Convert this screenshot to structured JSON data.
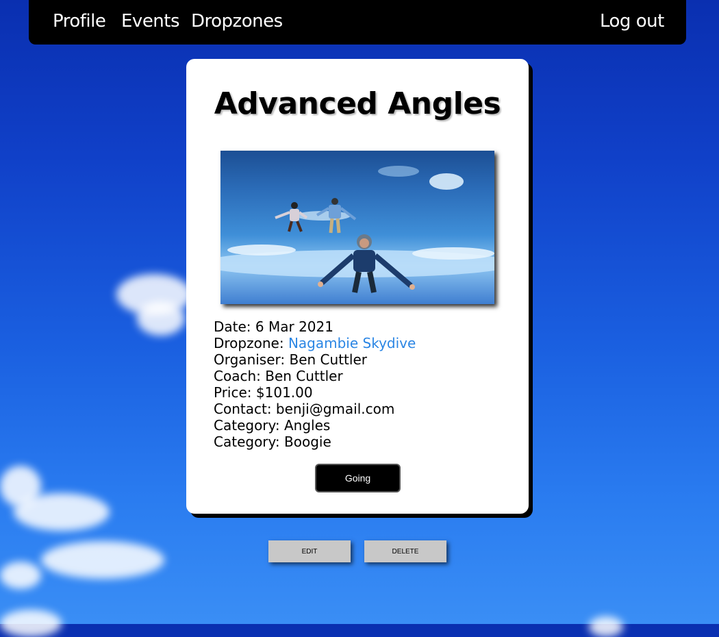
{
  "nav": {
    "links": [
      "Profile",
      "Events",
      "Dropzones"
    ],
    "logout_label": "Log out"
  },
  "event": {
    "title": "Advanced Angles",
    "date_label": "Date:",
    "date": "6 Mar 2021",
    "dropzone_label": "Dropzone:",
    "dropzone": "Nagambie Skydive",
    "organiser_label": "Organiser:",
    "organiser": "Ben Cuttler",
    "coach_label": "Coach:",
    "coach": "Ben Cuttler",
    "price_label": "Price:",
    "price": "$101.00",
    "contact_label": "Contact:",
    "contact": "benji@gmail.com",
    "categories": [
      {
        "label": "Category:",
        "value": "Angles"
      },
      {
        "label": "Category:",
        "value": "Boogie"
      }
    ],
    "going_label": "Going"
  },
  "actions": {
    "edit_label": "EDIT",
    "delete_label": "DELETE"
  },
  "colors": {
    "link": "#2b86e4",
    "navbar": "#000000",
    "card": "#ffffff",
    "action_button": "#c8c8c8"
  }
}
